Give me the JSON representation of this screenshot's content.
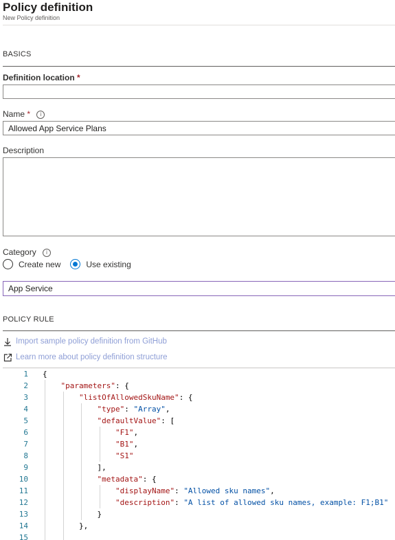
{
  "header": {
    "title": "Policy definition",
    "subtitle": "New Policy definition"
  },
  "sections": {
    "basics": "BASICS",
    "policy_rule": "POLICY RULE"
  },
  "fields": {
    "definition_location": {
      "label": "Definition location",
      "required": "*",
      "value": ""
    },
    "name": {
      "label": "Name",
      "required": "*",
      "info": "i",
      "value": "Allowed App Service Plans"
    },
    "description": {
      "label": "Description",
      "value": ""
    },
    "category": {
      "label": "Category",
      "info": "i",
      "value": "App Service"
    }
  },
  "category_options": {
    "create_new": "Create new",
    "use_existing": "Use existing",
    "selected": "use_existing"
  },
  "links": {
    "import_sample": "Import sample policy definition from GitHub",
    "learn_more": "Learn more about policy definition structure"
  },
  "editor": {
    "lines": [
      {
        "n": "1",
        "indent": 0,
        "tokens": [
          [
            "p",
            "{"
          ]
        ]
      },
      {
        "n": "2",
        "indent": 1,
        "tokens": [
          [
            "k",
            "\"parameters\""
          ],
          [
            "p",
            ": {"
          ]
        ]
      },
      {
        "n": "3",
        "indent": 2,
        "tokens": [
          [
            "k",
            "\"listOfAllowedSkuName\""
          ],
          [
            "p",
            ": {"
          ]
        ]
      },
      {
        "n": "4",
        "indent": 3,
        "tokens": [
          [
            "k",
            "\"type\""
          ],
          [
            "p",
            ": "
          ],
          [
            "s",
            "\"Array\""
          ],
          [
            "p",
            ","
          ]
        ]
      },
      {
        "n": "5",
        "indent": 3,
        "tokens": [
          [
            "k",
            "\"defaultValue\""
          ],
          [
            "p",
            ": ["
          ]
        ]
      },
      {
        "n": "6",
        "indent": 4,
        "tokens": [
          [
            "k",
            "\"F1\""
          ],
          [
            "p",
            ","
          ]
        ]
      },
      {
        "n": "7",
        "indent": 4,
        "tokens": [
          [
            "k",
            "\"B1\""
          ],
          [
            "p",
            ","
          ]
        ]
      },
      {
        "n": "8",
        "indent": 4,
        "tokens": [
          [
            "k",
            "\"S1\""
          ]
        ]
      },
      {
        "n": "9",
        "indent": 3,
        "tokens": [
          [
            "p",
            "],"
          ]
        ]
      },
      {
        "n": "10",
        "indent": 3,
        "tokens": [
          [
            "k",
            "\"metadata\""
          ],
          [
            "p",
            ": {"
          ]
        ]
      },
      {
        "n": "11",
        "indent": 4,
        "tokens": [
          [
            "k",
            "\"displayName\""
          ],
          [
            "p",
            ": "
          ],
          [
            "s",
            "\"Allowed sku names\""
          ],
          [
            "p",
            ","
          ]
        ]
      },
      {
        "n": "12",
        "indent": 4,
        "tokens": [
          [
            "k",
            "\"description\""
          ],
          [
            "p",
            ": "
          ],
          [
            "s",
            "\"A list of allowed sku names, example: F1;B1\""
          ]
        ]
      },
      {
        "n": "13",
        "indent": 3,
        "tokens": [
          [
            "p",
            "}"
          ]
        ]
      },
      {
        "n": "14",
        "indent": 2,
        "tokens": [
          [
            "p",
            "},"
          ]
        ]
      },
      {
        "n": "15",
        "indent": 2,
        "tokens": [
          [
            "p",
            ""
          ]
        ]
      }
    ]
  },
  "icons": {
    "download": "download-icon",
    "external_link": "external-link-icon",
    "info": "info-icon"
  },
  "colors": {
    "accent": "#0078d4",
    "required": "#a4262c",
    "focus_border": "#8764b8",
    "link": "#8e9ed6"
  }
}
